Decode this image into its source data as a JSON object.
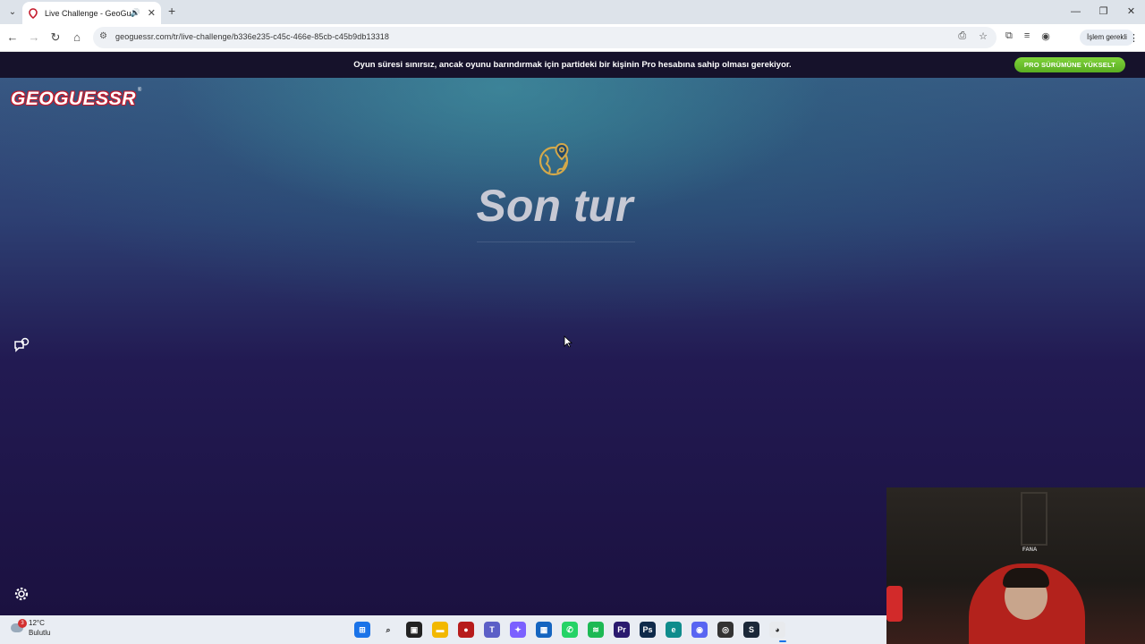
{
  "browser": {
    "tab_title": "Live Challenge - GeoGuessr",
    "url": "geoguessr.com/tr/live-challenge/b336e235-c45c-466e-85cb-c45b9db13318",
    "profile_chip": "İşlem gerekli"
  },
  "banner": {
    "message": "Oyun süresi sınırsız, ancak oyunu barındırmak için partideki bir kişinin Pro hesabına sahip olması gerekiyor.",
    "pro_button": "PRO SÜRÜMÜNE YÜKSELT"
  },
  "logo": {
    "text": "GEOGUESSR",
    "registered": "®"
  },
  "main": {
    "title": "Son tur",
    "icon": "globe-pin-icon"
  },
  "webcam": {
    "sign_text": "FANA"
  },
  "taskbar": {
    "weather_temp": "12°C",
    "weather_condition": "Bulutlu",
    "weather_badge": "3",
    "apps": [
      {
        "name": "start-icon",
        "color": "#1a73e8",
        "glyph": "⊞"
      },
      {
        "name": "search-icon",
        "color": "#e9edf3",
        "glyph": "⌕"
      },
      {
        "name": "task-view-icon",
        "color": "#222222",
        "glyph": "▣"
      },
      {
        "name": "file-explorer-icon",
        "color": "#f2b800",
        "glyph": "▬"
      },
      {
        "name": "red-app-icon",
        "color": "#b71c1c",
        "glyph": "●"
      },
      {
        "name": "teams-icon",
        "color": "#5b5fc7",
        "glyph": "T"
      },
      {
        "name": "copilot-icon",
        "color": "#7b61ff",
        "glyph": "✦"
      },
      {
        "name": "store-icon",
        "color": "#1565c0",
        "glyph": "▦"
      },
      {
        "name": "whatsapp-icon",
        "color": "#25d366",
        "glyph": "✆"
      },
      {
        "name": "spotify-icon",
        "color": "#1db954",
        "glyph": "≋"
      },
      {
        "name": "premiere-icon",
        "color": "#2a1a6e",
        "glyph": "Pr"
      },
      {
        "name": "photoshop-icon",
        "color": "#0f2a4a",
        "glyph": "Ps"
      },
      {
        "name": "edge-icon",
        "color": "#0f8c8c",
        "glyph": "e"
      },
      {
        "name": "discord-icon",
        "color": "#5865f2",
        "glyph": "◉"
      },
      {
        "name": "obs-icon",
        "color": "#333333",
        "glyph": "◎"
      },
      {
        "name": "steam-icon",
        "color": "#1b2838",
        "glyph": "S"
      },
      {
        "name": "chrome-icon",
        "color": "#e8eaed",
        "glyph": "◕"
      }
    ]
  },
  "colors": {
    "banner_bg": "#16122b",
    "pro_green": "#6cc02c",
    "logo_red": "#c41a2b",
    "globe_gold": "#d4a94a"
  }
}
